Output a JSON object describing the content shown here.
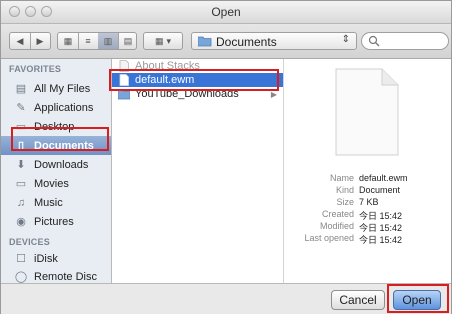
{
  "window": {
    "title": "Open"
  },
  "toolbar": {
    "popup_label": "Documents",
    "search_placeholder": ""
  },
  "sidebar": {
    "favorites_header": "FAVORITES",
    "devices_header": "DEVICES",
    "favorites": [
      {
        "label": "All My Files",
        "icon": "all-files-icon"
      },
      {
        "label": "Applications",
        "icon": "applications-icon"
      },
      {
        "label": "Desktop",
        "icon": "desktop-icon"
      },
      {
        "label": "Documents",
        "icon": "documents-icon",
        "selected": true
      },
      {
        "label": "Downloads",
        "icon": "downloads-icon"
      },
      {
        "label": "Movies",
        "icon": "movies-icon"
      },
      {
        "label": "Music",
        "icon": "music-icon"
      },
      {
        "label": "Pictures",
        "icon": "pictures-icon"
      }
    ],
    "devices": [
      {
        "label": "iDisk",
        "icon": "idisk-icon"
      },
      {
        "label": "Remote Disc",
        "icon": "remote-disc-icon"
      }
    ]
  },
  "files": [
    {
      "name": "About Stacks",
      "dimmed": true
    },
    {
      "name": "default.ewm",
      "selected": true
    },
    {
      "name": "YouTube_Downloads",
      "dimmed": false
    }
  ],
  "info": {
    "name_k": "Name",
    "name_v": "default.ewm",
    "kind_k": "Kind",
    "kind_v": "Document",
    "size_k": "Size",
    "size_v": "7 KB",
    "created_k": "Created",
    "created_v": "今日 15:42",
    "modified_k": "Modified",
    "modified_v": "今日 15:42",
    "opened_k": "Last opened",
    "opened_v": "今日 15:42"
  },
  "buttons": {
    "cancel": "Cancel",
    "open": "Open"
  },
  "colors": {
    "selection": "#3875d7",
    "highlight_box": "#d81e1e"
  }
}
